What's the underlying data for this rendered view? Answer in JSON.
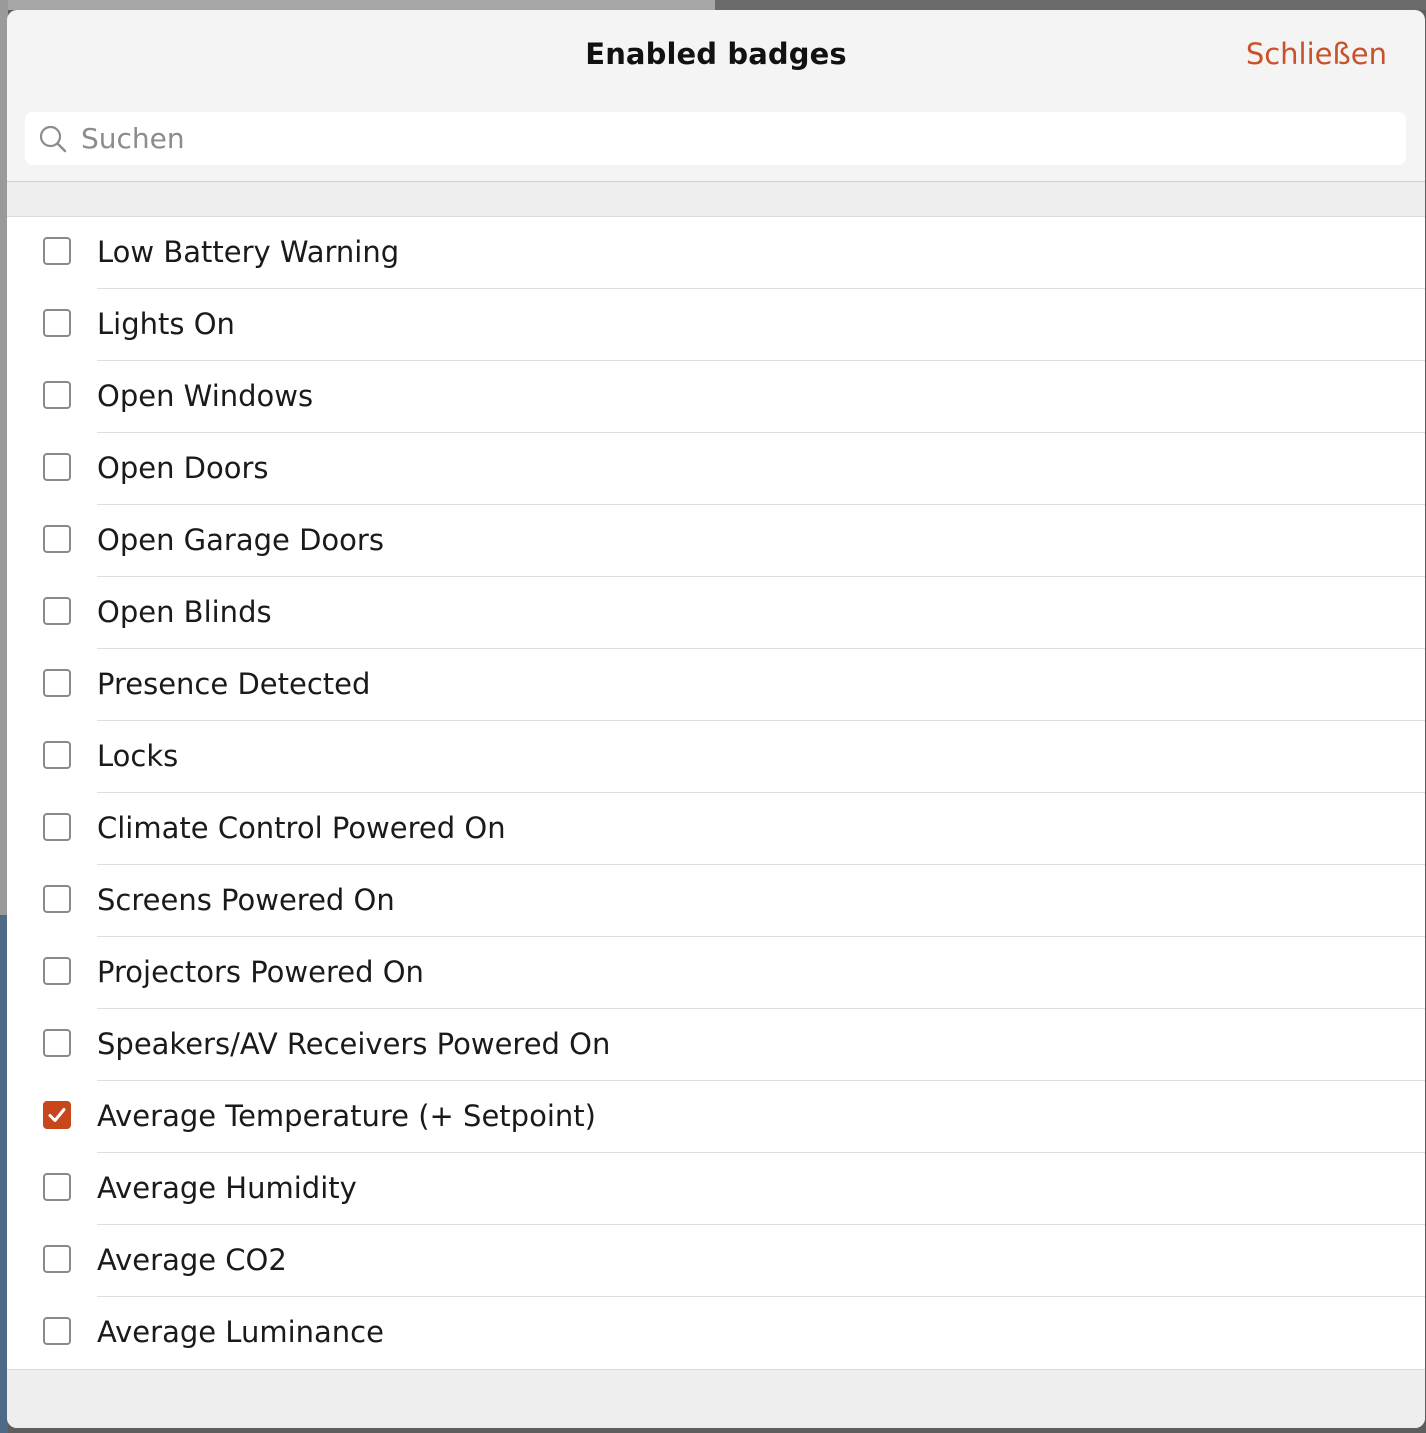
{
  "modal": {
    "title": "Enabled badges",
    "close_label": "Schließen"
  },
  "search": {
    "placeholder": "Suchen",
    "value": ""
  },
  "colors": {
    "accent": "#c8461c",
    "close_text": "#c8522a"
  },
  "badges": [
    {
      "label": "Low Battery Warning",
      "checked": false
    },
    {
      "label": "Lights On",
      "checked": false
    },
    {
      "label": "Open Windows",
      "checked": false
    },
    {
      "label": "Open Doors",
      "checked": false
    },
    {
      "label": "Open Garage Doors",
      "checked": false
    },
    {
      "label": "Open Blinds",
      "checked": false
    },
    {
      "label": "Presence Detected",
      "checked": false
    },
    {
      "label": "Locks",
      "checked": false
    },
    {
      "label": "Climate Control Powered On",
      "checked": false
    },
    {
      "label": "Screens Powered On",
      "checked": false
    },
    {
      "label": "Projectors Powered On",
      "checked": false
    },
    {
      "label": "Speakers/AV Receivers Powered On",
      "checked": false
    },
    {
      "label": "Average Temperature (+ Setpoint)",
      "checked": true
    },
    {
      "label": "Average Humidity",
      "checked": false
    },
    {
      "label": "Average CO2",
      "checked": false
    },
    {
      "label": "Average Luminance",
      "checked": false
    }
  ],
  "icons": {
    "search": "search-icon",
    "check": "checkmark-icon"
  }
}
